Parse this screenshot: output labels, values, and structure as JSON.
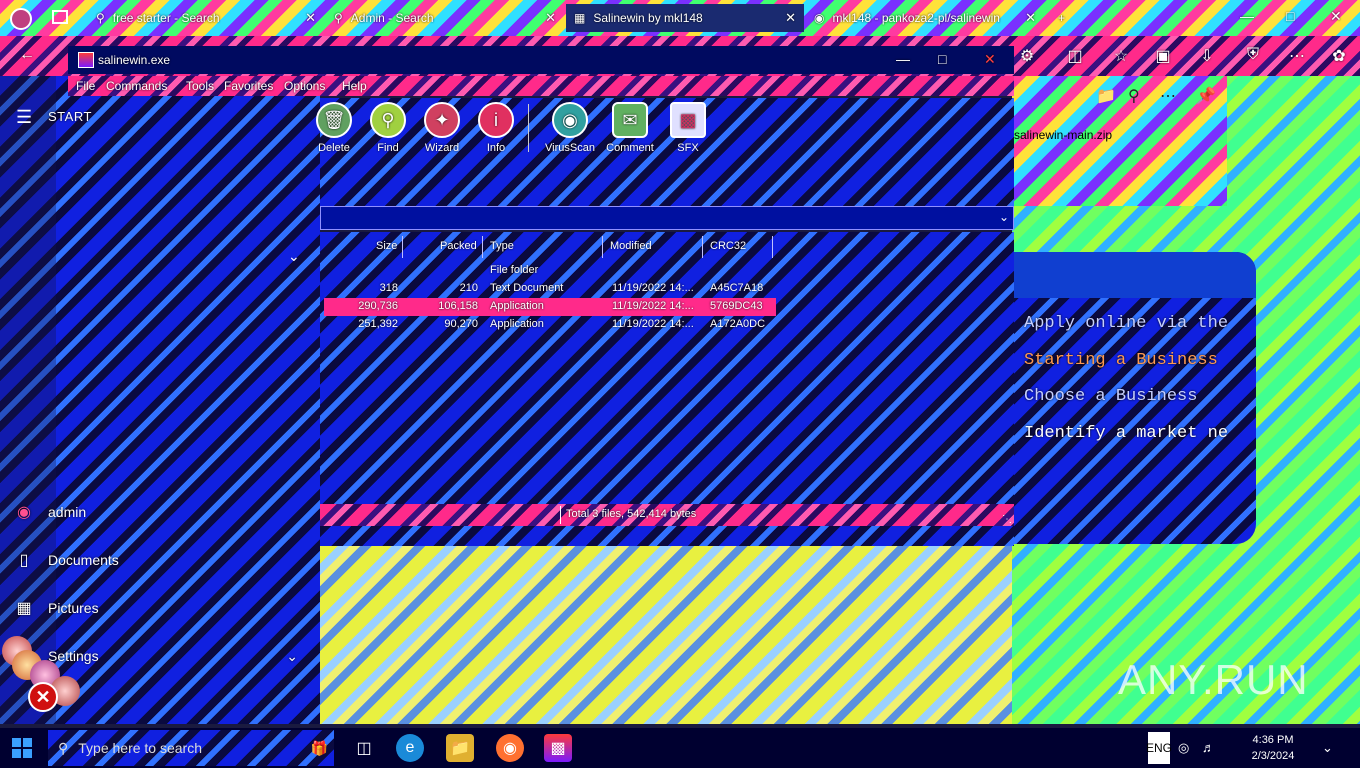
{
  "browser": {
    "tabs": [
      {
        "label": "free starter - Search",
        "icon": "search-icon"
      },
      {
        "label": "Admin - Search",
        "icon": "search-icon"
      },
      {
        "label": "Salinewin by mkl148",
        "icon": "image-icon"
      },
      {
        "label": "mkl148 - pankoza2-pl/salinewin",
        "icon": "github-icon"
      }
    ],
    "filename": "salinewin-main.zip"
  },
  "start_menu": {
    "title": "START",
    "items": [
      {
        "label": "admin",
        "icon": "user-icon"
      },
      {
        "label": "Documents",
        "icon": "document-icon"
      },
      {
        "label": "Pictures",
        "icon": "pictures-icon"
      },
      {
        "label": "Settings",
        "icon": "gear-icon"
      }
    ]
  },
  "winrar": {
    "title": "salinewin.exe",
    "menu": [
      "File",
      "Commands",
      "Tools",
      "Favorites",
      "Options",
      "Help"
    ],
    "toolbar": [
      "Delete",
      "Find",
      "Wizard",
      "Info",
      "VirusScan",
      "Comment",
      "SFX"
    ],
    "columns": [
      "Size",
      "Packed",
      "Type",
      "Modified",
      "CRC32"
    ],
    "rows": [
      {
        "size": "",
        "packed": "",
        "type": "File folder",
        "modified": "",
        "crc": "",
        "selected": false
      },
      {
        "size": "318",
        "packed": "210",
        "type": "Text Document",
        "modified": "11/19/2022 14:...",
        "crc": "A45C7A18",
        "selected": false
      },
      {
        "size": "290,736",
        "packed": "106,158",
        "type": "Application",
        "modified": "11/19/2022 14:...",
        "crc": "5769DC43",
        "selected": true
      },
      {
        "size": "251,392",
        "packed": "90,270",
        "type": "Application",
        "modified": "11/19/2022 14:...",
        "crc": "A172A0DC",
        "selected": false
      }
    ],
    "status": "Total 3 files, 542,414 bytes"
  },
  "background_page": {
    "lines": [
      "Apply online via the",
      "Starting a Business",
      "Choose a Business",
      "Identify a market ne"
    ]
  },
  "taskbar": {
    "search_placeholder": "Type here to search",
    "lang": "ENG",
    "time": "4:36 PM",
    "date": "2/3/2024"
  },
  "watermark": "ANY.RUN"
}
